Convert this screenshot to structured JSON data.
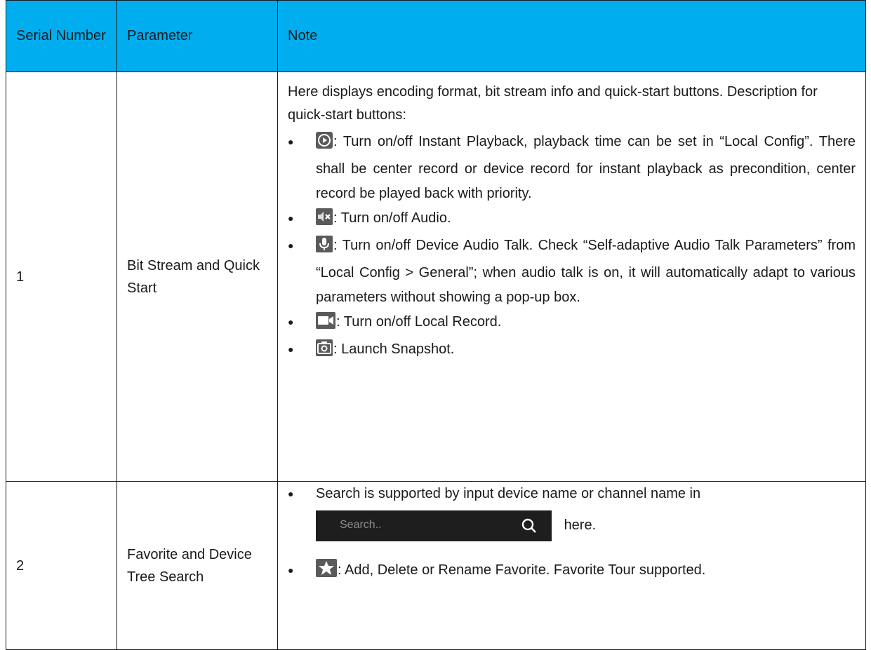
{
  "table": {
    "headers": {
      "serial": "Serial Number",
      "parameter": "Parameter",
      "note": "Note"
    },
    "rows": [
      {
        "serial": "1",
        "parameter": "Bit Stream and Quick Start",
        "intro": "Here displays encoding format, bit stream info and quick-start buttons. Description for quick-start buttons:",
        "bullets": [
          {
            "icon": "playback-icon",
            "text": ": Turn on/off Instant Playback, playback time can be set in “Local Config”. There shall be center record or device record for instant playback as precondition, center record be played back with priority."
          },
          {
            "icon": "audio-mute-icon",
            "text": ": Turn on/off Audio."
          },
          {
            "icon": "microphone-icon",
            "text": ": Turn on/off Device Audio Talk. Check “Self-adaptive Audio Talk Parameters” from “Local Config > General”; when audio talk is on, it will automatically adapt to various parameters without showing a pop-up box."
          },
          {
            "icon": "record-camera-icon",
            "text": ": Turn on/off Local Record."
          },
          {
            "icon": "snapshot-camera-icon",
            "text": ": Launch Snapshot."
          }
        ]
      },
      {
        "serial": "2",
        "parameter": "Favorite and Device Tree Search",
        "bullets": [
          {
            "text": "Search is supported by input device name or channel name in",
            "after_search": "here."
          },
          {
            "icon": "star-icon",
            "text": ": Add, Delete or Rename Favorite. Favorite Tour supported."
          }
        ],
        "search": {
          "placeholder": "Search..",
          "icon": "search-icon"
        }
      }
    ]
  },
  "colors": {
    "header_bg": "#00aeef",
    "icon_gray": "#595959",
    "search_bg": "#1e1e1e"
  }
}
